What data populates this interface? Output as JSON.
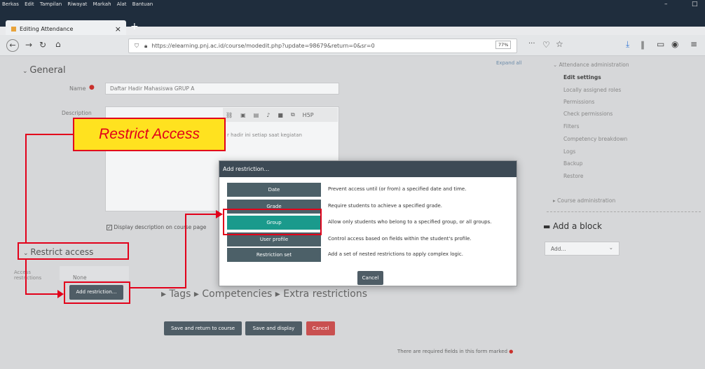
{
  "menubar": {
    "items": [
      "Berkas",
      "Edit",
      "Tampilan",
      "Riwayat",
      "Markah",
      "Alat",
      "Bantuan"
    ],
    "minimize": "–",
    "maximize": "□"
  },
  "tab": {
    "title": "Editing Attendance",
    "close": "×",
    "new_tab": "+"
  },
  "url": {
    "text": "https://elearning.pnj.ac.id/course/modedit.php?update=98679&return=0&sr=0",
    "zoom": "77%",
    "more": "···"
  },
  "page": {
    "general_heading": "General",
    "expand_all": "Expand all",
    "name_label": "Name",
    "name_value": "Daftar Hadir Mahasiswa GRUP A",
    "description_label": "Description",
    "editor_text": "r hadir ini setiap saat kegiatan",
    "display_desc": "Display description on course page",
    "restrict_heading": "Restrict access",
    "access_label_1": "Access",
    "access_label_2": "restrictions",
    "none_text": "None",
    "add_restriction": "Add restriction...",
    "tags_line": "Tags ▸ Competencies ▸ Extra restrictions",
    "save_return": "Save and return to course",
    "save_display": "Save and display",
    "cancel": "Cancel",
    "required_note": "There are required fields in this form marked"
  },
  "sidebar": {
    "attendance_admin": "Attendance administration",
    "items": [
      "Edit settings",
      "Locally assigned roles",
      "Permissions",
      "Check permissions",
      "Filters",
      "Competency breakdown",
      "Logs",
      "Backup",
      "Restore"
    ],
    "course_admin": "Course administration",
    "add_block": "Add a block",
    "add_select": "Add..."
  },
  "dialog": {
    "title": "Add restriction...",
    "options": [
      {
        "label": "Date",
        "desc": "Prevent access until (or from) a specified date and time."
      },
      {
        "label": "Grade",
        "desc": "Require students to achieve a specified grade."
      },
      {
        "label": "Group",
        "desc": "Allow only students who belong to a specified group, or all groups."
      },
      {
        "label": "User profile",
        "desc": "Control access based on fields within the student's profile."
      },
      {
        "label": "Restriction set",
        "desc": "Add a set of nested restrictions to apply complex logic."
      }
    ],
    "cancel": "Cancel"
  },
  "annotation": {
    "label": "Restrict Access"
  },
  "colors": {
    "accent_red": "#e2001a",
    "group_teal": "#1a9a8c",
    "option_btn": "#4c6068"
  }
}
